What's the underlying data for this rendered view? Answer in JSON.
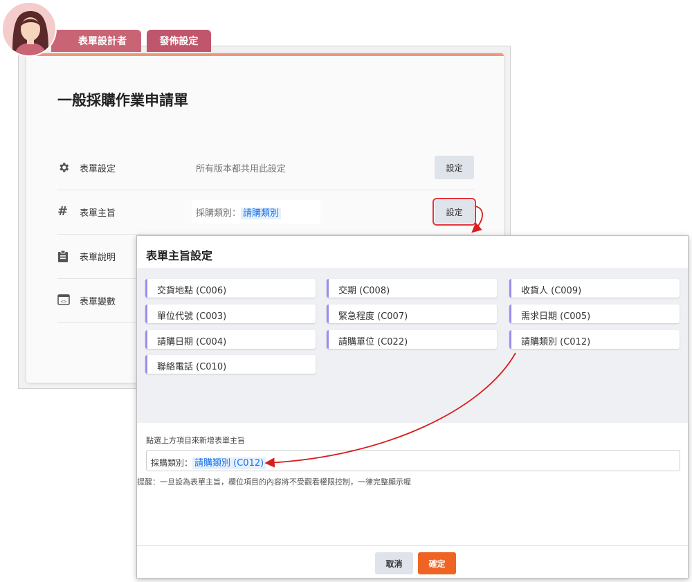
{
  "tabs": {
    "designer": "表單設計者",
    "publish": "發佈設定"
  },
  "form": {
    "title": "一般採購作業申請單",
    "rows": [
      {
        "icon": "gear-icon",
        "label": "表單設定",
        "desc": "所有版本都共用此設定",
        "button": "設定"
      },
      {
        "icon": "hash-icon",
        "label": "表單主旨",
        "subject_prefix": "採購類別：",
        "subject_value": "請購類別",
        "button": "設定"
      },
      {
        "icon": "clipboard-icon",
        "label": "表單說明"
      },
      {
        "icon": "code-window-icon",
        "label": "表單變數"
      }
    ]
  },
  "modal": {
    "title": "表單主旨設定",
    "fields": [
      "交貨地點 (C006)",
      "交期 (C008)",
      "收貨人 (C009)",
      "單位代號 (C003)",
      "緊急程度 (C007)",
      "需求日期 (C005)",
      "請購日期 (C004)",
      "請購單位 (C022)",
      "請購類別 (C012)",
      "聯絡電話 (C010)"
    ],
    "hint": "點選上方項目來新增表單主旨",
    "subject_prefix": "採購類別：",
    "subject_value": "請購類別 (C012)",
    "note": "提醒：一旦設為表單主旨，欄位項目的內容將不受觀看權限控制，一律完整顯示喔",
    "cancel": "取消",
    "ok": "確定"
  },
  "colors": {
    "accent": "#f06423",
    "tab": "#c0566b",
    "highlight": "#e5343c",
    "link": "#1a73e8"
  }
}
